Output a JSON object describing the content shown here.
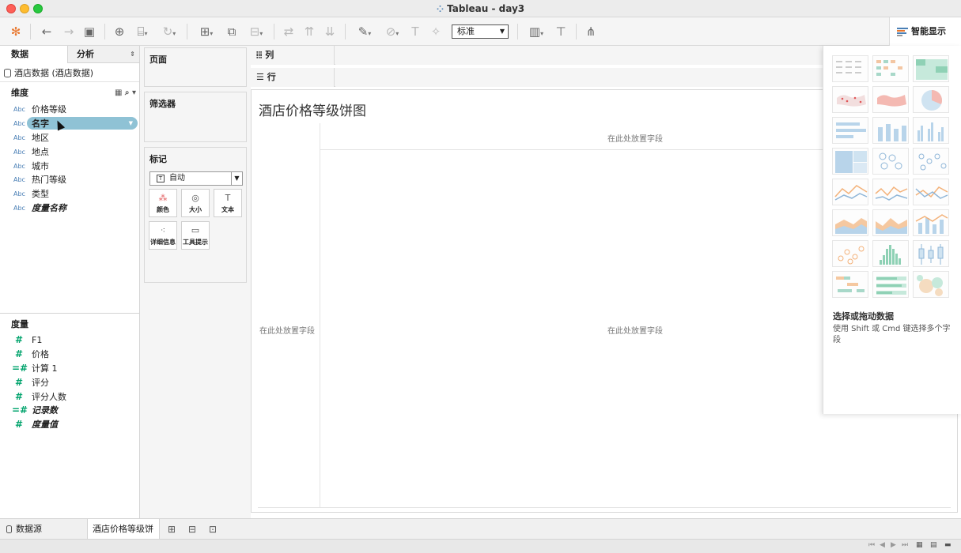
{
  "window": {
    "title": "Tableau - day3"
  },
  "toolbar": {
    "mark_size_select": "标准",
    "show_me_label": "智能显示"
  },
  "data_pane": {
    "tabs": [
      "数据",
      "分析"
    ],
    "datasource": "酒店数据 (酒店数据)",
    "dimensions_header": "维度",
    "dimensions": [
      {
        "type": "Abc",
        "name": "价格等级",
        "italic": false
      },
      {
        "type": "Abc",
        "name": "名字",
        "italic": false,
        "selected": true
      },
      {
        "type": "Abc",
        "name": "地区",
        "italic": false
      },
      {
        "type": "Abc",
        "name": "地点",
        "italic": false
      },
      {
        "type": "Abc",
        "name": "城市",
        "italic": false
      },
      {
        "type": "Abc",
        "name": "热门等级",
        "italic": false
      },
      {
        "type": "Abc",
        "name": "类型",
        "italic": false
      },
      {
        "type": "Abc",
        "name": "度量名称",
        "italic": true
      }
    ],
    "measures_header": "度量",
    "measures": [
      {
        "type": "#",
        "name": "F1",
        "italic": false
      },
      {
        "type": "#",
        "name": "价格",
        "italic": false
      },
      {
        "type": "=#",
        "name": "计算 1",
        "italic": false
      },
      {
        "type": "#",
        "name": "评分",
        "italic": false
      },
      {
        "type": "#",
        "name": "评分人数",
        "italic": false
      },
      {
        "type": "=#",
        "name": "记录数",
        "italic": true
      },
      {
        "type": "#",
        "name": "度量值",
        "italic": true
      }
    ]
  },
  "cards": {
    "pages": "页面",
    "filters": "筛选器",
    "marks": "标记",
    "mark_type": "自动",
    "mark_buttons": [
      "颜色",
      "大小",
      "文本",
      "详细信息",
      "工具提示"
    ]
  },
  "shelves": {
    "columns": "列",
    "rows": "行"
  },
  "view": {
    "title": "酒店价格等级饼图",
    "drop_field_top": "在此处放置字段",
    "drop_field_left": "在此处放置字段",
    "drop_field_center": "在此处放置字段"
  },
  "show_me": {
    "hint_title": "选择或拖动数据",
    "hint_desc": "使用 Shift 或 Cmd 键选择多个字段"
  },
  "bottom": {
    "data_source_tab": "数据源",
    "sheet_tab": "酒店价格等级饼图"
  },
  "colors": {
    "selected_pill": "#8fc2d5",
    "dimension": "#4a7fb5",
    "measure": "#00a36c"
  }
}
